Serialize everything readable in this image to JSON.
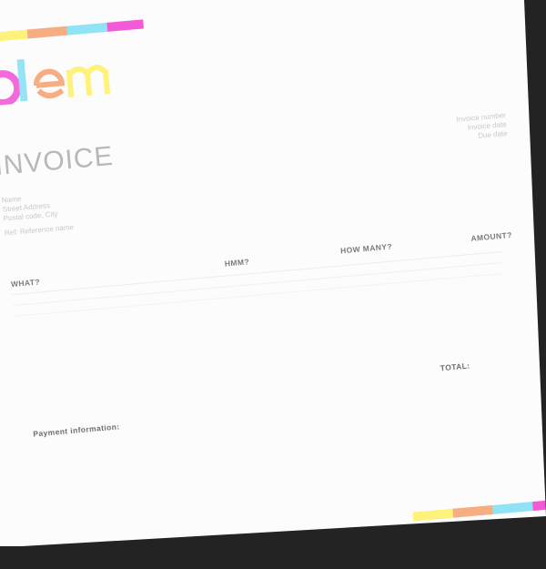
{
  "colors": {
    "yellow": "#fff27a",
    "orange": "#f6ad82",
    "cyan": "#8fe3f4",
    "magenta": "#f35ad8"
  },
  "logo": {
    "text": "olem"
  },
  "invoice": {
    "title": "INVOICE",
    "meta": [
      "Invoice number",
      "Invoice date",
      "Due date"
    ]
  },
  "client": {
    "lines": [
      "Name",
      "Street Address",
      "Postal code, City"
    ],
    "reference": "Ref: Reference name"
  },
  "table": {
    "headers": {
      "what": "WHAT?",
      "hmm": "HMM?",
      "how_many": "HOW MANY?",
      "amount": "AMOUNT?"
    }
  },
  "total": {
    "label": "TOTAL:"
  },
  "payment": {
    "title": "Payment information:"
  }
}
